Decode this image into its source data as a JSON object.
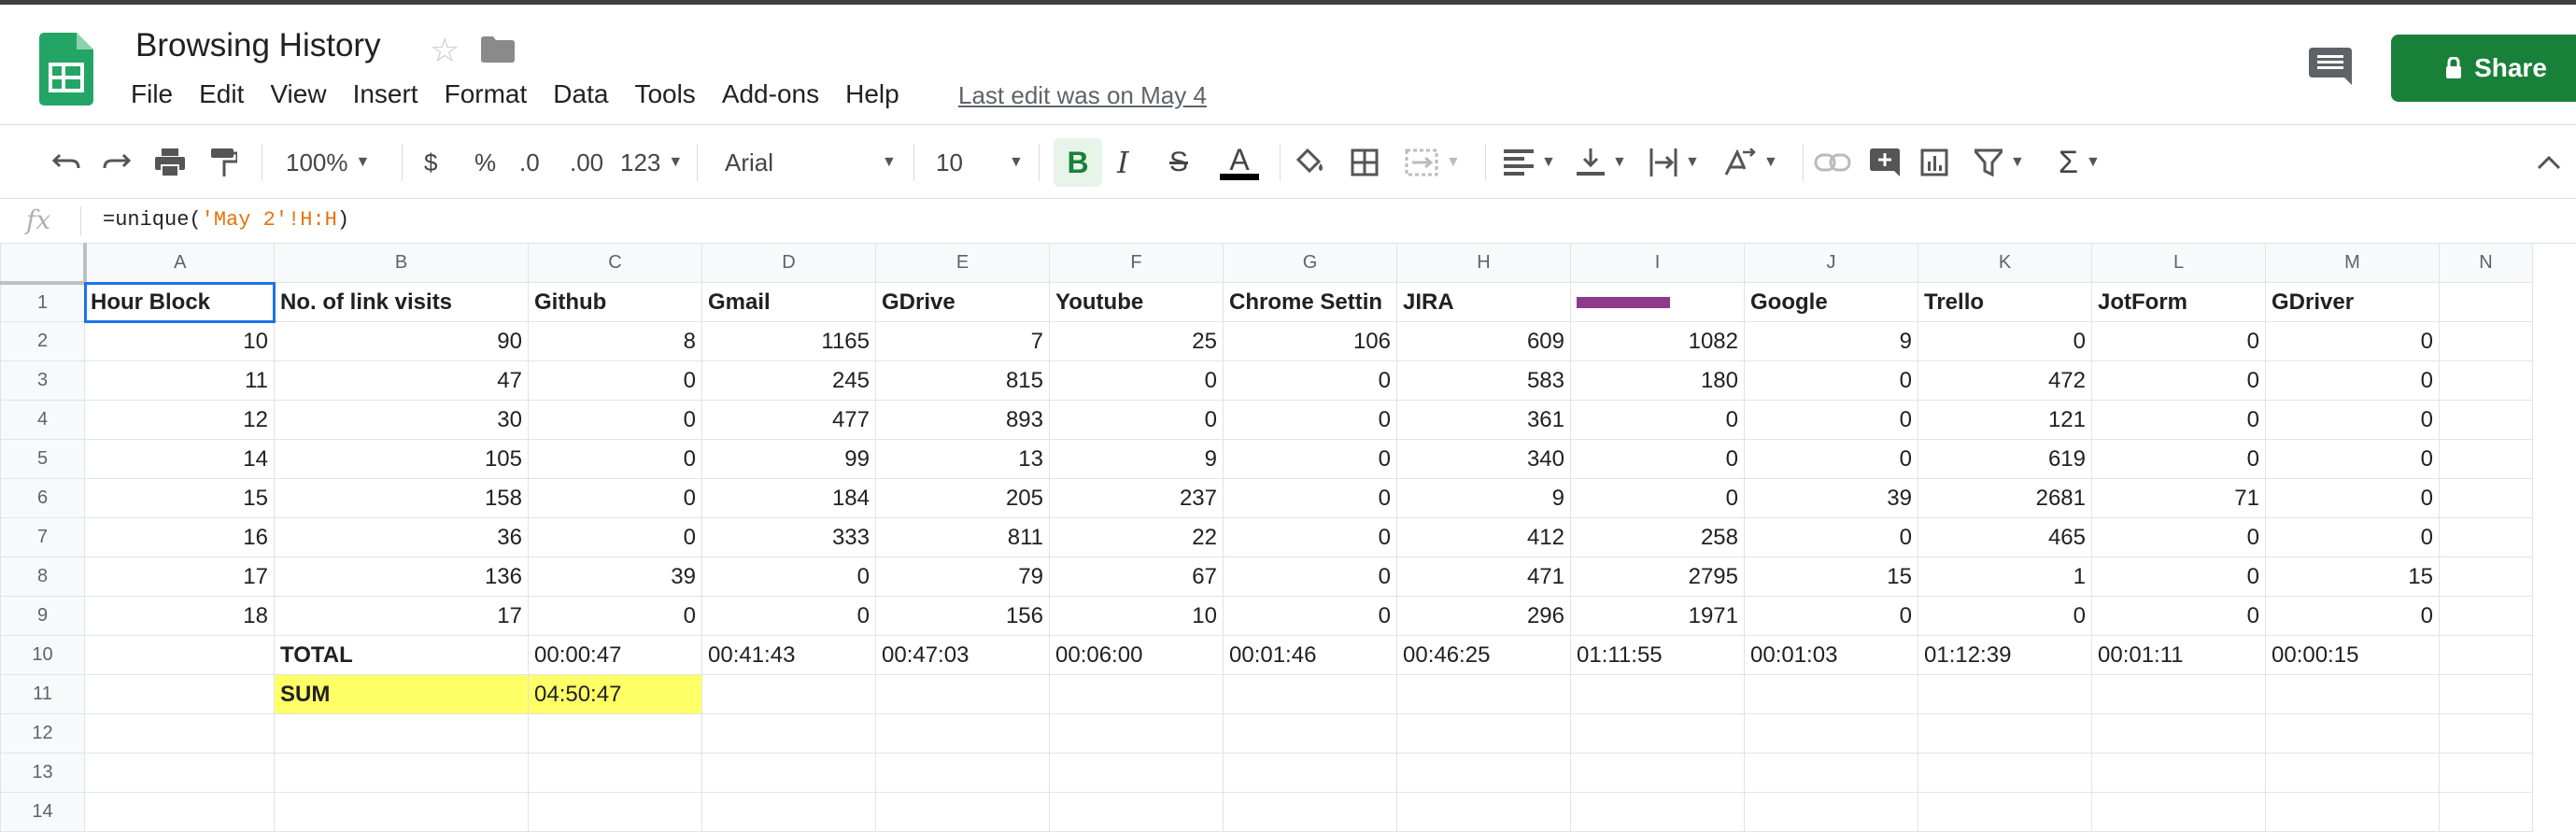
{
  "doc": {
    "title": "Browsing History",
    "last_edit": "Last edit was on May 4",
    "share_label": "Share"
  },
  "menu": [
    "File",
    "Edit",
    "View",
    "Insert",
    "Format",
    "Data",
    "Tools",
    "Add-ons",
    "Help"
  ],
  "toolbar": {
    "zoom": "100%",
    "currency": "$",
    "percent": "%",
    "dec_less": ".0",
    "dec_more": ".00",
    "format_more": "123",
    "font": "Arial",
    "font_size": "10",
    "bold": "B",
    "italic": "I",
    "strike": "S",
    "text_color": "A",
    "sigma": "Σ"
  },
  "formula_bar": {
    "fx": "fx",
    "prefix": "=unique(",
    "string": "'May 2'!H:H",
    "suffix": ")"
  },
  "grid": {
    "columns": [
      "A",
      "B",
      "C",
      "D",
      "E",
      "F",
      "G",
      "H",
      "I",
      "J",
      "K",
      "L",
      "M",
      "N"
    ],
    "row_numbers": [
      "1",
      "2",
      "3",
      "4",
      "5",
      "6",
      "7",
      "8",
      "9",
      "10",
      "11",
      "12",
      "13",
      "14"
    ],
    "headers": [
      "Hour Block",
      "No. of link visits",
      "Github",
      "Gmail",
      "GDrive",
      "Youtube",
      "Chrome Settin",
      "JIRA",
      "",
      "Google",
      "Trello",
      "JotForm",
      "GDriver"
    ],
    "data_rows": [
      [
        "10",
        "90",
        "8",
        "1165",
        "7",
        "25",
        "106",
        "609",
        "1082",
        "9",
        "0",
        "0",
        "0"
      ],
      [
        "11",
        "47",
        "0",
        "245",
        "815",
        "0",
        "0",
        "583",
        "180",
        "0",
        "472",
        "0",
        "0"
      ],
      [
        "12",
        "30",
        "0",
        "477",
        "893",
        "0",
        "0",
        "361",
        "0",
        "0",
        "121",
        "0",
        "0"
      ],
      [
        "14",
        "105",
        "0",
        "99",
        "13",
        "9",
        "0",
        "340",
        "0",
        "0",
        "619",
        "0",
        "0"
      ],
      [
        "15",
        "158",
        "0",
        "184",
        "205",
        "237",
        "0",
        "9",
        "0",
        "39",
        "2681",
        "71",
        "0"
      ],
      [
        "16",
        "36",
        "0",
        "333",
        "811",
        "22",
        "0",
        "412",
        "258",
        "0",
        "465",
        "0",
        "0"
      ],
      [
        "17",
        "136",
        "39",
        "0",
        "79",
        "67",
        "0",
        "471",
        "2795",
        "15",
        "1",
        "0",
        "15"
      ],
      [
        "18",
        "17",
        "0",
        "0",
        "156",
        "10",
        "0",
        "296",
        "1971",
        "0",
        "0",
        "0",
        "0"
      ]
    ],
    "total_label": "TOTAL",
    "totals": [
      "00:00:47",
      "00:41:43",
      "00:47:03",
      "00:06:00",
      "00:01:46",
      "00:46:25",
      "01:11:55",
      "00:01:03",
      "01:12:39",
      "00:01:11",
      "00:00:15"
    ],
    "sum_label": "SUM",
    "sum_value": "04:50:47"
  },
  "colors": {
    "brand_green": "#188038",
    "selection_blue": "#1a73e8",
    "highlight_yellow": "#ffff66",
    "redaction_purple": "#8e3b8e"
  }
}
